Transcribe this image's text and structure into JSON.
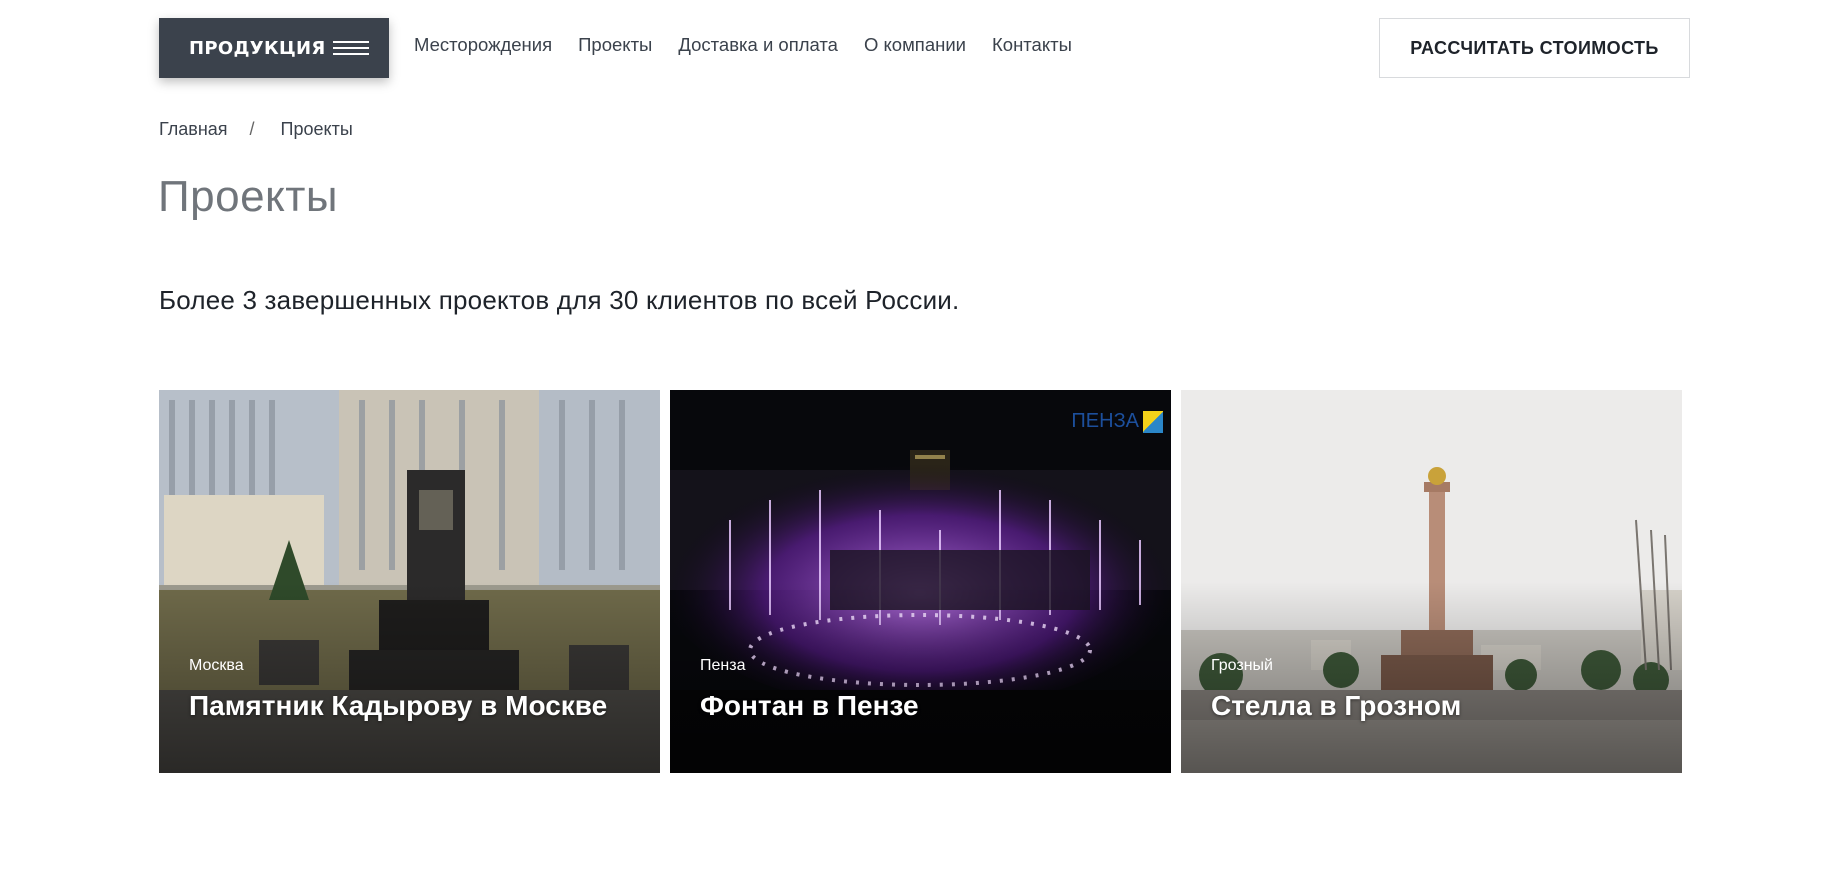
{
  "header": {
    "products_label": "ПРОДУКЦИЯ",
    "nav": [
      "Месторождения",
      "Проекты",
      "Доставка и оплата",
      "О компании",
      "Контакты"
    ],
    "calc_label": "РАССЧИТАТЬ СТОИМОСТЬ"
  },
  "breadcrumb": {
    "home": "Главная",
    "separator": "/",
    "current": "Проекты"
  },
  "page": {
    "title": "Проекты",
    "subtitle": "Более 3 завершенных проектов для 30 клиентов по всей России."
  },
  "projects": [
    {
      "city": "Москва",
      "name": "Памятник Кадырову в Москве"
    },
    {
      "city": "Пенза",
      "name": "Фонтан в Пензе",
      "logo_text": "ПЕНЗА"
    },
    {
      "city": "Грозный",
      "name": "Стелла в Грозном"
    }
  ],
  "colors": {
    "primary_dark": "#3b424c",
    "title_gray": "#70757b",
    "fountain_purple": "#9b3fd8"
  }
}
